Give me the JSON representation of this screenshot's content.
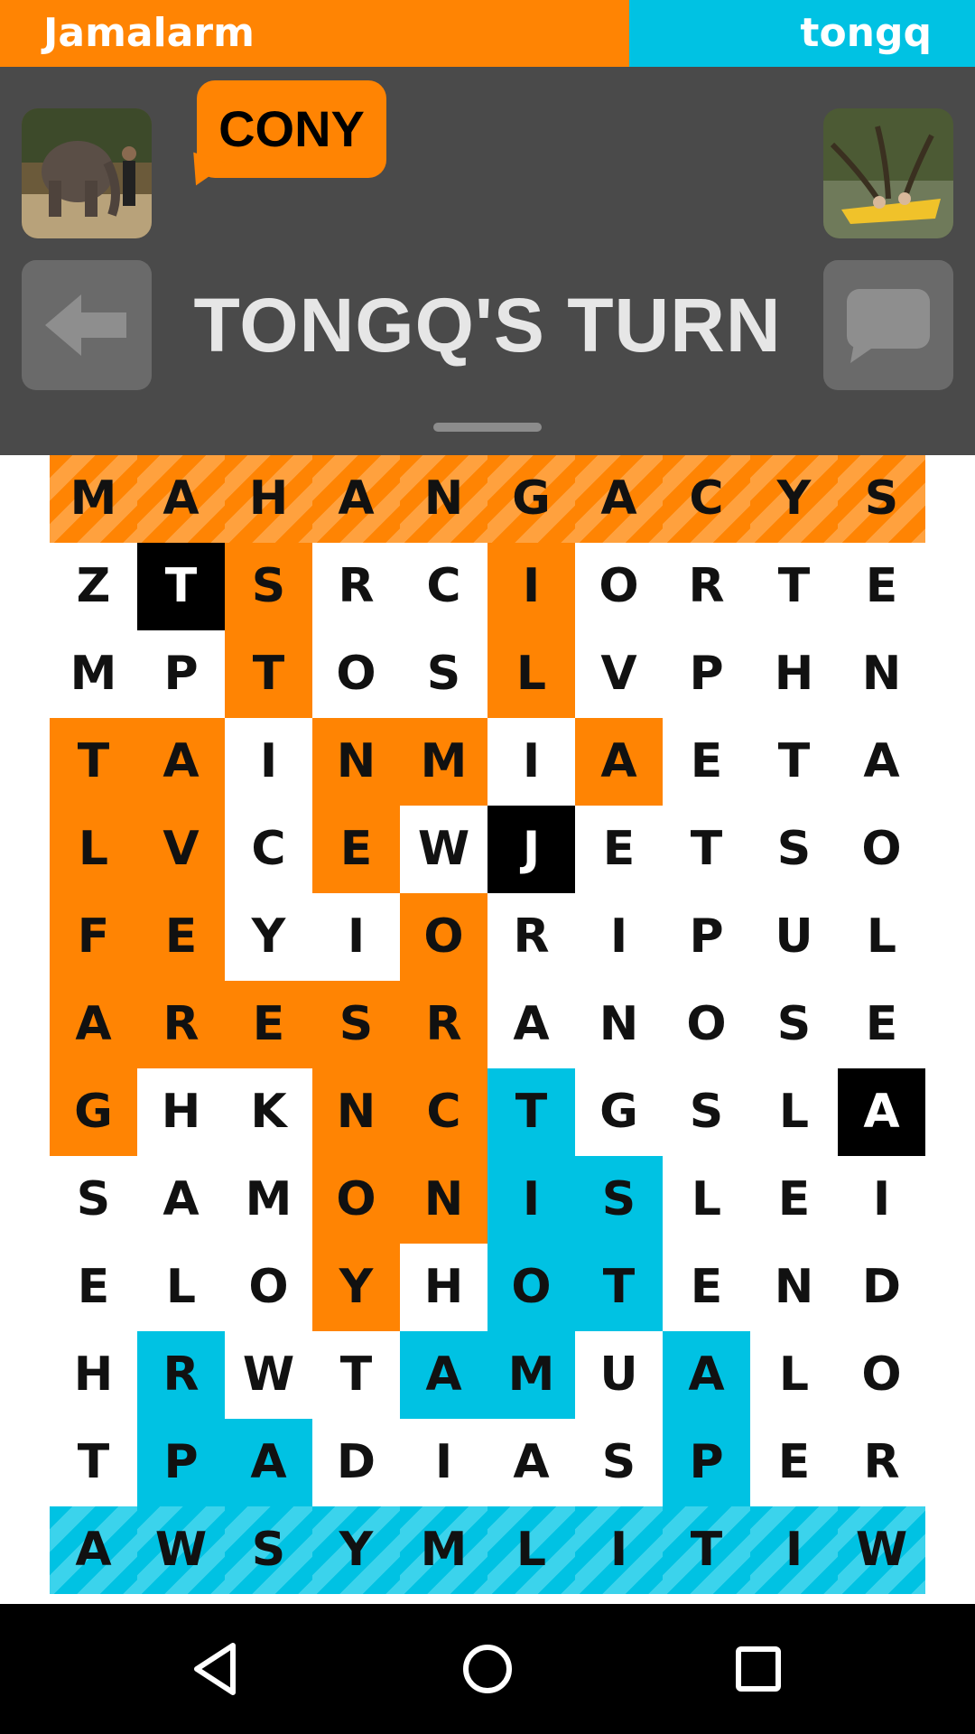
{
  "players": {
    "left": {
      "name": "Jamalarm",
      "color": "#ff8403"
    },
    "right": {
      "name": "tongq",
      "color": "#00c2e3"
    }
  },
  "header": {
    "played_word": "CONY",
    "turn_text": "TONGQ'S TURN",
    "back_icon": "arrow-left-icon",
    "chat_icon": "chat-bubble-icon"
  },
  "board": {
    "rows": [
      "MAHANGACYS",
      "ZTSRCIORTE",
      "MPTOSLVPHN",
      "TAINMIAETA",
      "LVCEWJETSO",
      "FEYIORIPUL",
      "ARESRANOSE",
      "GHKNCTGSLA",
      "SAMONISLEI",
      "ELOYHOTEND",
      "HRWTAMUALO",
      "TPADIASPER",
      "AWSYMLITIW"
    ],
    "owners": [
      "SSSSSSSSSS",
      "_KO__O____",
      "__O__O____",
      "OO_OO_O___",
      "OO_O_K____",
      "OO__O_____",
      "OOOOO_____",
      "O__OOB___K",
      "___OOBB___",
      "___O_BB___",
      "_B__BB_B__",
      "_BB____B__",
      "TTTTTTTTTT"
    ],
    "legend": {
      "_": "empty",
      "O": "orange-owned",
      "B": "blue-owned",
      "K": "black-special",
      "S": "orange-striped-home",
      "T": "blue-striped-home"
    }
  },
  "navbar": {
    "back": "triangle-back-icon",
    "home": "circle-home-icon",
    "recent": "square-recents-icon"
  }
}
